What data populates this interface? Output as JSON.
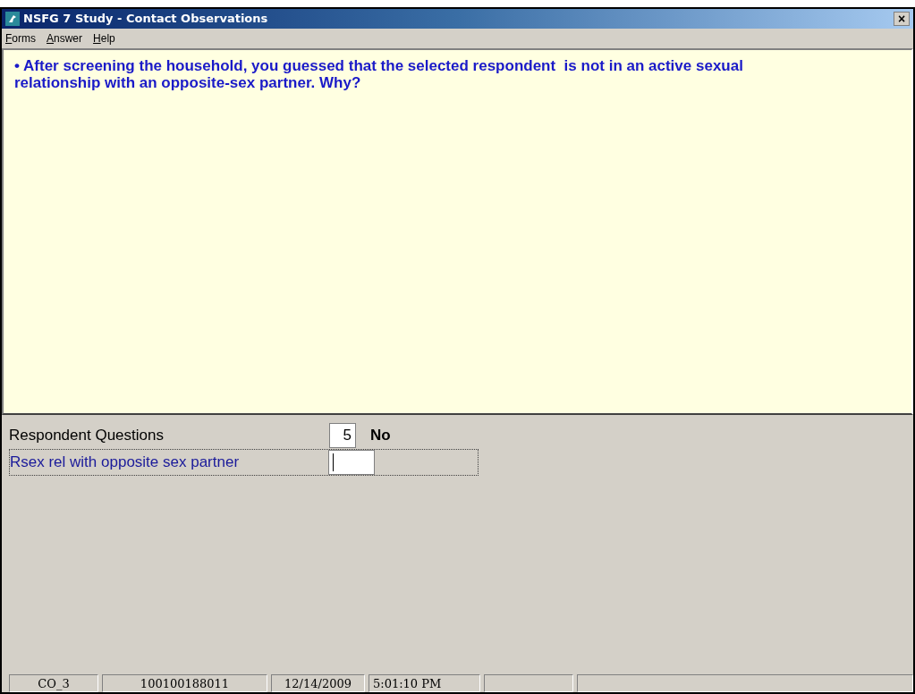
{
  "window": {
    "title": "NSFG 7 Study - Contact Observations",
    "close": "×"
  },
  "menu": [
    "Forms",
    "Answer",
    "Help"
  ],
  "question": "• After screening the household, you guessed that the selected respondent  is not in an active sexual relationship with an opposite-sex partner. Why?",
  "rows": [
    {
      "kind": "section",
      "label": "Respondent Questions",
      "value": "5",
      "answer": "No"
    },
    {
      "kind": "question",
      "label": "Rsex rel with opposite sex partner",
      "selected": true
    }
  ],
  "status_bar": [
    "CO_3",
    "100100188011",
    "12/14/2009",
    "5:01:10 PM"
  ]
}
